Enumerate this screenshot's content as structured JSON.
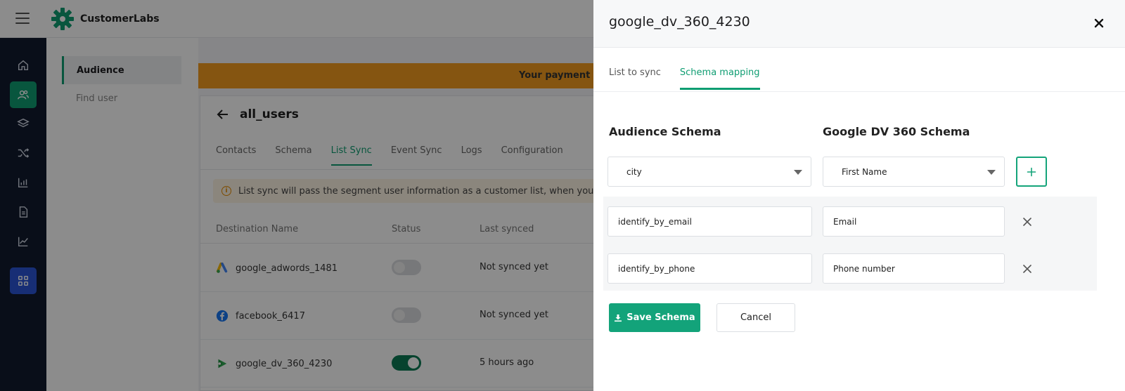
{
  "app": {
    "brand": "CustomerLabs",
    "brand_color": "#0f9d72"
  },
  "subnav": {
    "items": [
      {
        "label": "Audience"
      },
      {
        "label": "Find user"
      }
    ]
  },
  "content": {
    "banner_text": "Your payment c",
    "page_title": "all_users",
    "tabs": [
      "Contacts",
      "Schema",
      "List Sync",
      "Event Sync",
      "Logs",
      "Configuration"
    ],
    "info_text": "List sync will pass the segment user information as a customer list, when you ha",
    "table": {
      "headers": [
        "Destination Name",
        "Status",
        "Last synced"
      ],
      "rows": [
        {
          "name": "google_adwords_1481",
          "icon": "google-ads-icon",
          "status_on": false,
          "last_synced": "Not synced yet"
        },
        {
          "name": "facebook_6417",
          "icon": "facebook-icon",
          "status_on": false,
          "last_synced": "Not synced yet"
        },
        {
          "name": "google_dv_360_4230",
          "icon": "google-dv360-icon",
          "status_on": true,
          "last_synced": "5 hours ago"
        }
      ]
    }
  },
  "drawer": {
    "title": "google_dv_360_4230",
    "tabs": [
      {
        "label": "List to sync",
        "active": false
      },
      {
        "label": "Schema mapping",
        "active": true
      }
    ],
    "audience_schema_title": "Audience Schema",
    "google_schema_title": "Google DV 360 Schema",
    "new_mapping": {
      "audience_selected": "city",
      "google_selected": "First Name"
    },
    "mappings": [
      {
        "audience": "identify_by_email",
        "google": "Email"
      },
      {
        "audience": "identify_by_phone",
        "google": "Phone number"
      }
    ],
    "save_label": "Save Schema",
    "cancel_label": "Cancel"
  }
}
